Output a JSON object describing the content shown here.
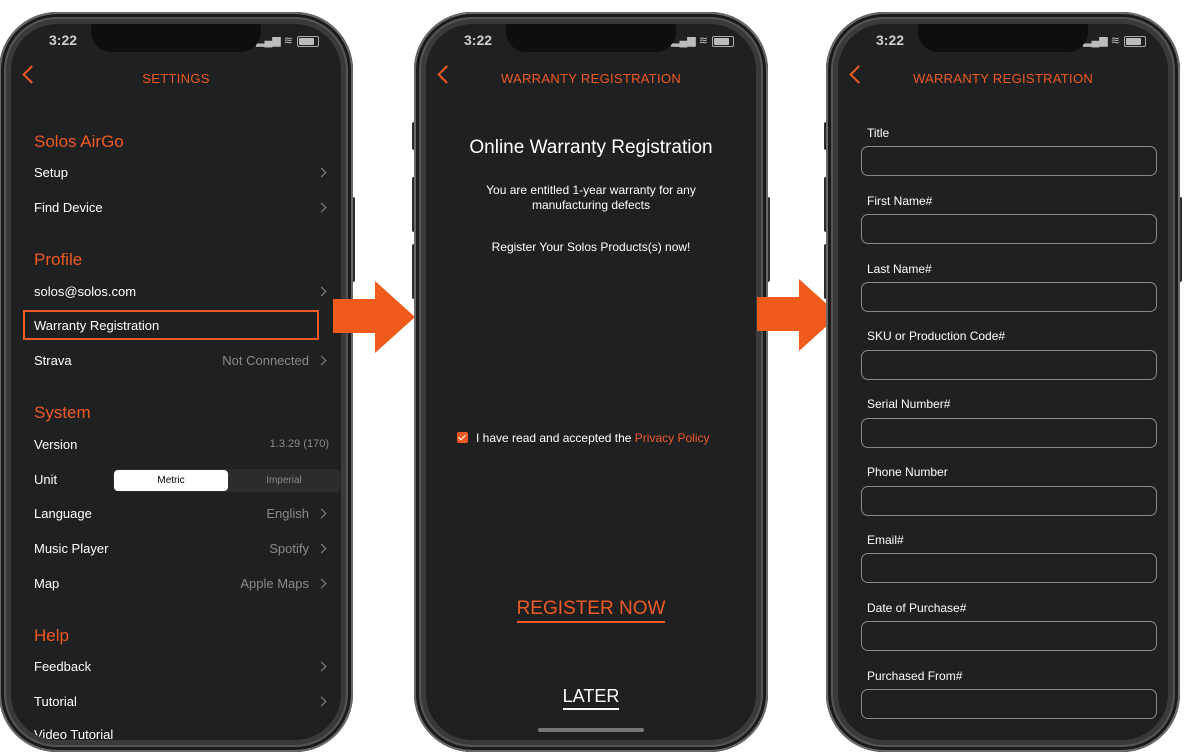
{
  "status": {
    "time": "3:22"
  },
  "colors": {
    "accent": "#ee5a24",
    "arrow": "#f05a1a",
    "screen_bg": "#1f2021"
  },
  "settings": {
    "nav_title": "SETTINGS",
    "sections": [
      {
        "title": "Solos AirGo",
        "items": [
          {
            "label": "Setup",
            "value": ""
          },
          {
            "label": "Find Device",
            "value": ""
          }
        ]
      },
      {
        "title": "Profile",
        "items": [
          {
            "label": "solos@solos.com",
            "value": ""
          },
          {
            "label": "Warranty Registration",
            "value": ""
          },
          {
            "label": "Strava",
            "value": "Not Connected"
          }
        ]
      },
      {
        "title": "System",
        "items": [
          {
            "label": "Version",
            "value": "1.3.29 (170)"
          },
          {
            "label": "Unit",
            "value": ""
          },
          {
            "label": "Language",
            "value": "English"
          },
          {
            "label": "Music Player",
            "value": "Spotify"
          },
          {
            "label": "Map",
            "value": "Apple Maps"
          }
        ]
      },
      {
        "title": "Help",
        "items": [
          {
            "label": "Feedback",
            "value": ""
          },
          {
            "label": "Tutorial",
            "value": ""
          },
          {
            "label": "Video Tutorial",
            "value": ""
          }
        ]
      }
    ],
    "unit_options": [
      "Metric",
      "Imperial"
    ],
    "unit_selected": "Metric"
  },
  "warranty_intro": {
    "nav_title": "WARRANTY REGISTRATION",
    "title": "Online Warranty Registration",
    "text1": "You are entitled 1-year warranty for any manufacturing defects",
    "text2": "Register Your Solos Products(s) now!",
    "checkbox_text": "I have read and accepted the",
    "checkbox_link": "Privacy Policy",
    "checkbox_checked": true,
    "register_button": "REGISTER NOW",
    "later_button": "LATER"
  },
  "warranty_form": {
    "nav_title": "WARRANTY REGISTRATION",
    "fields": [
      {
        "label": "Title",
        "value": ""
      },
      {
        "label": "First Name#",
        "value": ""
      },
      {
        "label": "Last Name#",
        "value": ""
      },
      {
        "label": "SKU or Production Code#",
        "value": ""
      },
      {
        "label": "Serial Number#",
        "value": ""
      },
      {
        "label": "Phone Number",
        "value": ""
      },
      {
        "label": "Email#",
        "value": ""
      },
      {
        "label": "Date of Purchase#",
        "value": ""
      },
      {
        "label": "Purchased From#",
        "value": ""
      }
    ]
  },
  "icons": {
    "back": "chevron-left-icon",
    "row": "chevron-right-icon",
    "flow": "arrow-right-icon",
    "checkbox": "checkbox-checked-icon"
  }
}
